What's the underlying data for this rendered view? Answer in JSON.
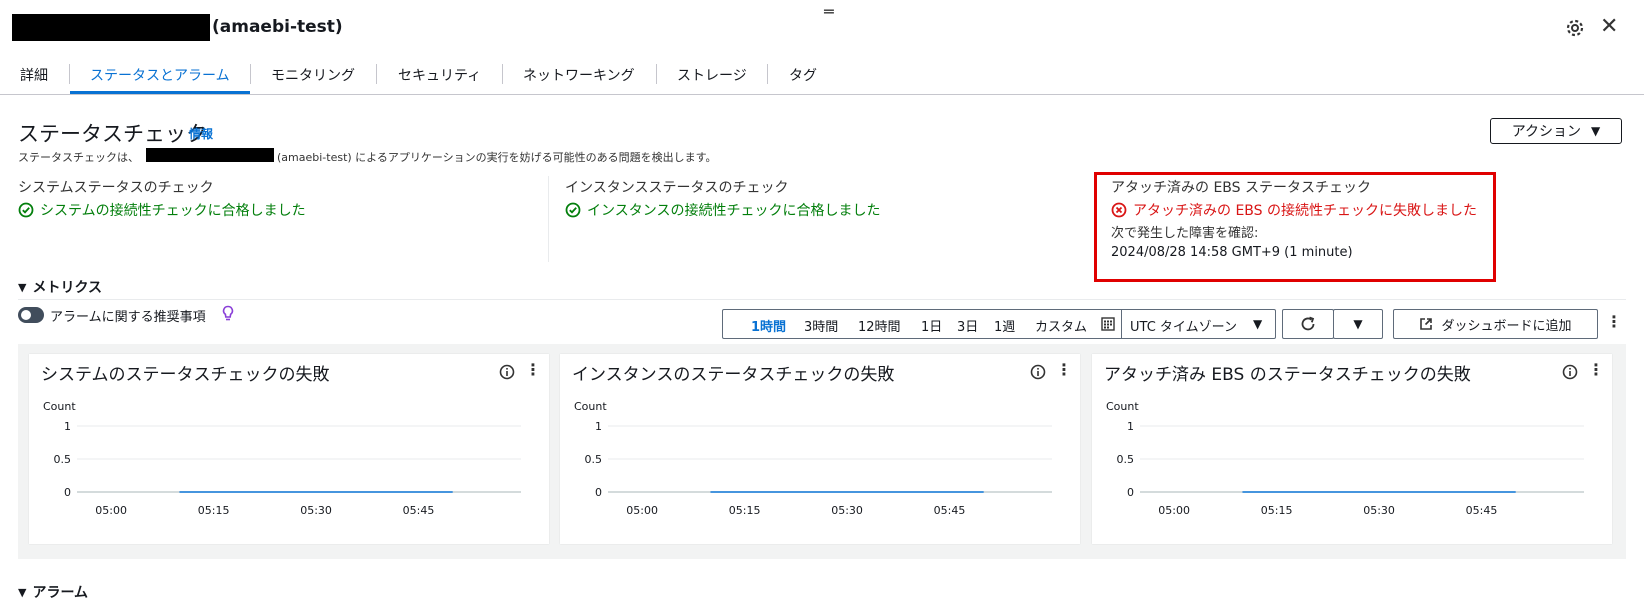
{
  "header": {
    "title_suffix": "(amaebi-test)",
    "drag_glyph": "═"
  },
  "tabs": [
    {
      "label": "詳細",
      "active": false
    },
    {
      "label": "ステータスとアラーム",
      "active": true
    },
    {
      "label": "モニタリング",
      "active": false
    },
    {
      "label": "セキュリティ",
      "active": false
    },
    {
      "label": "ネットワーキング",
      "active": false
    },
    {
      "label": "ストレージ",
      "active": false
    },
    {
      "label": "タグ",
      "active": false
    }
  ],
  "status_check": {
    "title": "ステータスチェック",
    "info_link": "情報",
    "desc_prefix": "ステータスチェックは、",
    "desc_suffix": "(amaebi-test) によるアプリケーションの実行を妨げる可能性のある問題を検出します。",
    "action_button": "アクション",
    "columns": [
      {
        "title": "システムステータスのチェック",
        "status": "ok",
        "message": "システムの接続性チェックに合格しました"
      },
      {
        "title": "インスタンスステータスのチェック",
        "status": "ok",
        "message": "インスタンスの接続性チェックに合格しました"
      },
      {
        "title": "アタッチ済みの EBS ステータスチェック",
        "status": "fail",
        "message": "アタッチ済みの EBS の接続性チェックに失敗しました",
        "detail_label": "次で発生した障害を確認:",
        "detail_time": "2024/08/28 14:58 GMT+9 (1 minute)"
      }
    ]
  },
  "metrics": {
    "section_title": "メトリクス",
    "alarm_toggle_label": "アラームに関する推奨事項",
    "time_ranges": [
      "1時間",
      "3時間",
      "12時間",
      "1日",
      "3日",
      "1週",
      "カスタム"
    ],
    "selected_range": "1時間",
    "timezone": "UTC タイムゾーン",
    "add_dashboard": "ダッシュボードに追加",
    "charts": [
      {
        "title": "システムのステータスチェックの失敗"
      },
      {
        "title": "インスタンスのステータスチェックの失敗"
      },
      {
        "title": "アタッチ済み EBS のステータスチェックの失敗"
      }
    ]
  },
  "alarms": {
    "section_title": "アラーム"
  },
  "colors": {
    "accent": "#0972d3",
    "ok": "#037f0c",
    "fail": "#d91515",
    "highlight_box": "#e00000",
    "series_line": "#0972d3"
  },
  "chart_data": [
    {
      "type": "line",
      "title": "システムのステータスチェックの失敗",
      "ylabel": "Count",
      "ylim": [
        0,
        1
      ],
      "yticks": [
        "0",
        "0.5",
        "1"
      ],
      "xticks": [
        "05:00",
        "05:15",
        "05:30",
        "05:45"
      ],
      "x": [
        "05:10",
        "05:50"
      ],
      "series": [
        {
          "values": [
            0,
            0
          ]
        }
      ]
    },
    {
      "type": "line",
      "title": "インスタンスのステータスチェックの失敗",
      "ylabel": "Count",
      "ylim": [
        0,
        1
      ],
      "yticks": [
        "0",
        "0.5",
        "1"
      ],
      "xticks": [
        "05:00",
        "05:15",
        "05:30",
        "05:45"
      ],
      "x": [
        "05:10",
        "05:50"
      ],
      "series": [
        {
          "values": [
            0,
            0
          ]
        }
      ]
    },
    {
      "type": "line",
      "title": "アタッチ済み EBS のステータスチェックの失敗",
      "ylabel": "Count",
      "ylim": [
        0,
        1
      ],
      "yticks": [
        "0",
        "0.5",
        "1"
      ],
      "xticks": [
        "05:00",
        "05:15",
        "05:30",
        "05:45"
      ],
      "x": [
        "05:10",
        "05:50"
      ],
      "series": [
        {
          "values": [
            0,
            0
          ]
        }
      ]
    }
  ]
}
